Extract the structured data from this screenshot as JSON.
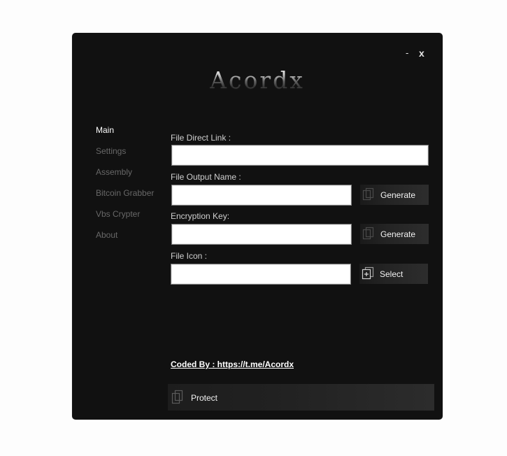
{
  "window": {
    "minimize_label": "-",
    "close_label": "x",
    "logo_text": "Acordx"
  },
  "nav": {
    "items": [
      {
        "label": "Main",
        "active": true
      },
      {
        "label": "Settings"
      },
      {
        "label": "Assembly"
      },
      {
        "label": "Bitcoin Grabber"
      },
      {
        "label": "Vbs Crypter"
      },
      {
        "label": "About"
      }
    ]
  },
  "form": {
    "direct_link": {
      "label": "File Direct Link :",
      "value": ""
    },
    "output_name": {
      "label": "File Output Name :",
      "value": "",
      "button_label": "Generate",
      "button_icon": "copy-icon"
    },
    "encryption_key": {
      "label": "Encryption Key:",
      "value": "",
      "button_label": "Generate",
      "button_icon": "copy-icon"
    },
    "file_icon": {
      "label": "File Icon :",
      "value": "",
      "button_label": "Select",
      "button_icon": "add-file-icon"
    }
  },
  "credit": "Coded By : https://t.me/Acordx",
  "protect": {
    "label": "Protect",
    "icon": "copy-icon"
  },
  "colors": {
    "window_bg": "#111111",
    "page_bg": "#fdfdfd",
    "nav_inactive": "#686868",
    "nav_active": "#ffffff"
  }
}
